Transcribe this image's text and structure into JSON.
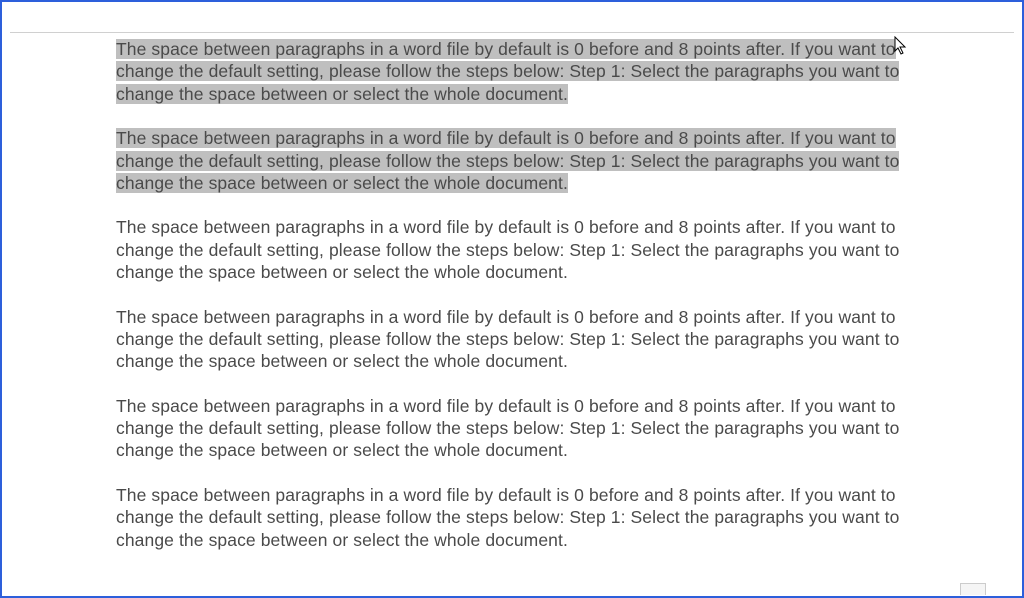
{
  "document": {
    "paragraphs": [
      {
        "text": "The space between paragraphs in a word file by default is 0 before and 8 points after. If you want to change the default setting, please follow the steps below: Step 1: Select the paragraphs you want to change the space between or select the whole document.",
        "highlighted": true
      },
      {
        "text": "The space between paragraphs in a word file by default is 0 before and 8 points after. If you want to change the default setting, please follow the steps below: Step 1: Select the paragraphs you want to change the space between or select the whole document.",
        "highlighted": true
      },
      {
        "text": "The space between paragraphs in a word file by default is 0 before and 8 points after. If you want to change the default setting, please follow the steps below: Step 1: Select the paragraphs you want to change the space between or select the whole document.",
        "highlighted": false
      },
      {
        "text": "The space between paragraphs in a word file by default is 0 before and 8 points after. If you want to change the default setting, please follow the steps below: Step 1: Select the paragraphs you want to change the space between or select the whole document.",
        "highlighted": false
      },
      {
        "text": "The space between paragraphs in a word file by default is 0 before and 8 points after. If you want to change the default setting, please follow the steps below: Step 1: Select the paragraphs you want to change the space between or select the whole document.",
        "highlighted": false
      },
      {
        "text": "The space between paragraphs in a word file by default is 0 before and 8 points after. If you want to change the default setting, please follow the steps below: Step 1: Select the paragraphs you want to change the space between or select the whole document.",
        "highlighted": false
      }
    ]
  },
  "selection": {
    "color": "#bfbfbf"
  }
}
